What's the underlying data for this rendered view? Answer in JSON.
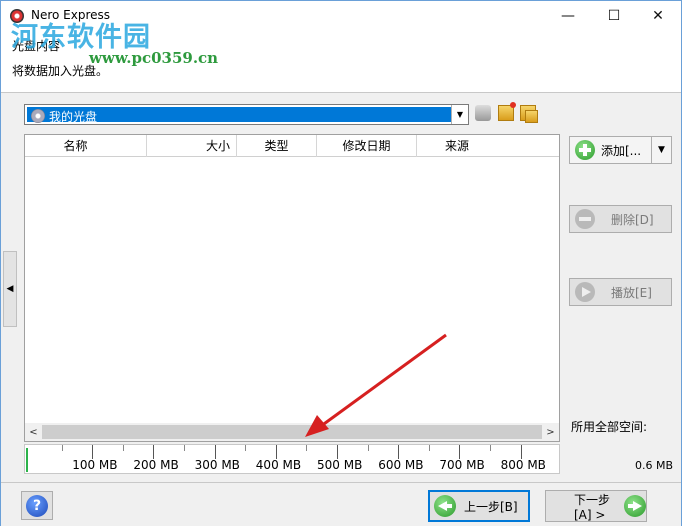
{
  "window": {
    "title": "Nero Express",
    "minimize_glyph": "—",
    "maximize_glyph": "☐",
    "close_glyph": "✕"
  },
  "watermark": {
    "text": "河东软件园",
    "url": "www.pc0359.cn"
  },
  "header": {
    "title": "光盘内容",
    "subtitle": "将数据加入光盘。"
  },
  "disc_selector": {
    "selected": "我的光盘"
  },
  "list": {
    "columns": [
      "名称",
      "大小",
      "类型",
      "修改日期",
      "来源"
    ],
    "rows": []
  },
  "capacity": {
    "ticks": [
      "100 MB",
      "200 MB",
      "300 MB",
      "400 MB",
      "500 MB",
      "600 MB",
      "700 MB",
      "800 MB"
    ],
    "used_label": "所用全部空间:",
    "used_value": "0.6 MB",
    "used_mb": 0.6,
    "fill_color": "#2cb34a"
  },
  "buttons": {
    "add": "添加[...",
    "delete": "删除[D]",
    "play": "播放[E]",
    "back": "上一步[B]",
    "next": "下一步[A] >",
    "help": "?"
  },
  "colors": {
    "selection": "#0078d7",
    "annotation_arrow": "#d62020",
    "accent_green": "#2a9a2a"
  },
  "icons": {
    "collapse": "chevron-left-icon",
    "disc": "disc-icon",
    "add": "plus-circle-icon",
    "delete": "minus-circle-icon",
    "play": "play-circle-icon",
    "back": "arrow-left-circle-icon",
    "next": "arrow-right-circle-icon",
    "help": "help-icon"
  }
}
